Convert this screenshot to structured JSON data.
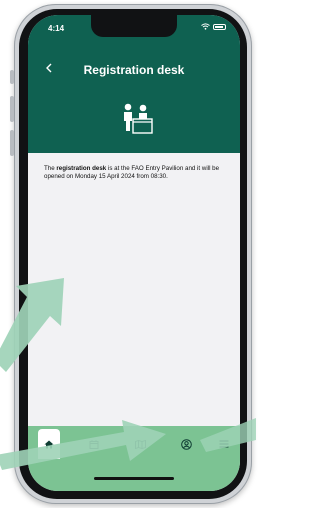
{
  "status_bar": {
    "time": "4:14",
    "wifi_icon": "wifi-icon",
    "battery_icon": "battery-icon"
  },
  "header": {
    "back_icon": "chevron-left-icon",
    "title": "Registration desk",
    "illustration_icon": "registration-desk-icon",
    "background_color": "#0f6151"
  },
  "content": {
    "intro_prefix": "The ",
    "bold_term": "registration desk",
    "intro_suffix": " is at the FAO Entry Pavilion and it will be opened on Monday 15 April 2024 from 08:30."
  },
  "tab_bar": {
    "background_color": "#7cc393",
    "items": [
      {
        "icon": "home-icon",
        "active": true
      },
      {
        "icon": "calendar-icon",
        "active": false
      },
      {
        "icon": "map-icon",
        "active": false
      },
      {
        "icon": "profile-icon",
        "active": false
      },
      {
        "icon": "menu-icon",
        "active": false
      }
    ]
  },
  "annotation": {
    "arrow_color": "#9ed3b7"
  }
}
